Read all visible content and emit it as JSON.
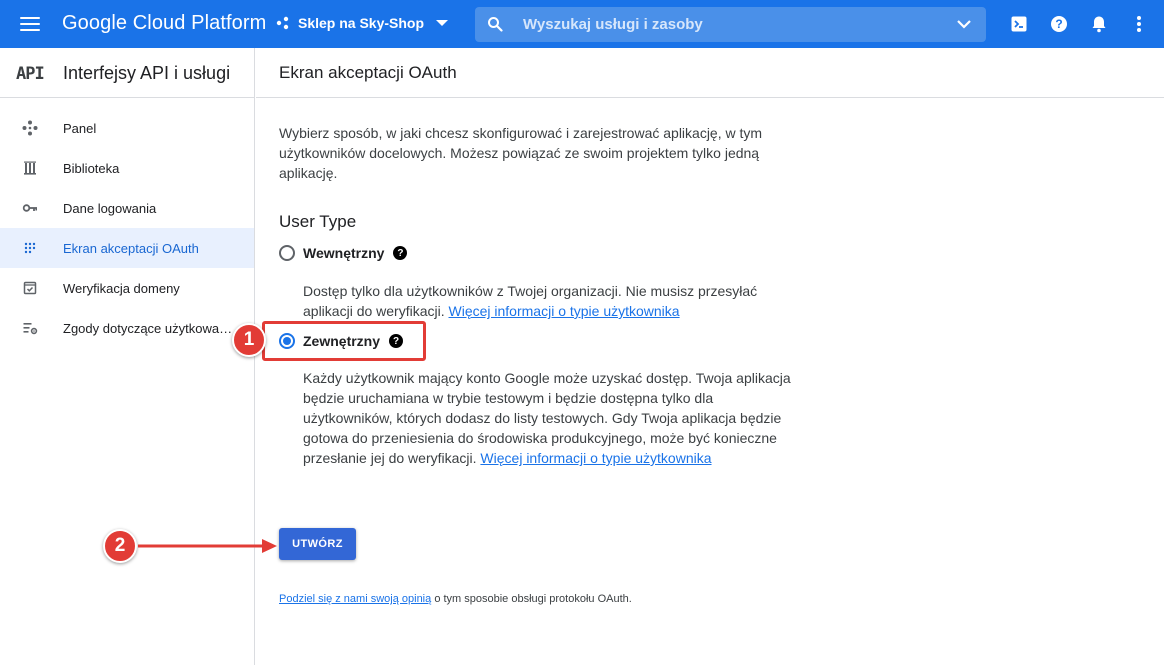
{
  "topbar": {
    "brand": "Google Cloud Platform",
    "project": "Sklep na Sky-Shop",
    "search_placeholder": "Wyszukaj usługi i zasoby",
    "icons": [
      "cloud-shell-icon",
      "help-icon",
      "notifications-icon",
      "more-vert-icon"
    ],
    "color": "#1a73e8"
  },
  "sidebar": {
    "logo": "API",
    "title": "Interfejsy API i usługi",
    "items": [
      {
        "label": "Panel",
        "icon": "dashboard-icon",
        "active": false
      },
      {
        "label": "Biblioteka",
        "icon": "library-icon",
        "active": false
      },
      {
        "label": "Dane logowania",
        "icon": "key-icon",
        "active": false
      },
      {
        "label": "Ekran akceptacji OAuth",
        "icon": "oauth-consent-icon",
        "active": true
      },
      {
        "label": "Weryfikacja domeny",
        "icon": "domain-verification-icon",
        "active": false
      },
      {
        "label": "Zgody dotyczące użytkowan…",
        "icon": "page-usage-agreements-icon",
        "active": false
      }
    ]
  },
  "main": {
    "title": "Ekran akceptacji OAuth",
    "intro": "Wybierz sposób, w jaki chcesz skonfigurować i zarejestrować aplikację, w tym użytkowników docelowych. Możesz powiązać ze swoim projektem tylko jedną aplikację.",
    "user_type_title": "User Type",
    "internal": {
      "label": "Wewnętrzny",
      "checked": false,
      "desc": "Dostęp tylko dla użytkowników z Twojej organizacji. Nie musisz przesyłać aplikacji do weryfikacji.",
      "link": "Więcej informacji o typie użytkownika"
    },
    "external": {
      "label": "Zewnętrzny",
      "checked": true,
      "desc": "Każdy użytkownik mający konto Google może uzyskać dostęp. Twoja aplikacja będzie uruchamiana w trybie testowym i będzie dostępna tylko dla użytkowników, których dodasz do listy testowych. Gdy Twoja aplikacja będzie gotowa do przeniesienia do środowiska produkcyjnego, może być konieczne przesłanie jej do weryfikacji.",
      "link": "Więcej informacji o typie użytkownika"
    },
    "create_button": "UTWÓRZ",
    "feedback_link": "Podziel się z nami swoją opinią",
    "feedback_text": "o tym sposobie obsługi protokołu OAuth."
  },
  "annotations": {
    "badge1": "1",
    "badge2": "2",
    "color": "#e23c36"
  }
}
